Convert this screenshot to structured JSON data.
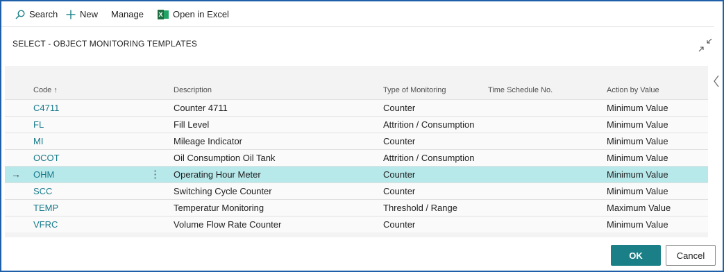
{
  "toolbar": {
    "search_label": "Search",
    "new_label": "New",
    "manage_label": "Manage",
    "excel_label": "Open in Excel",
    "excel_icon_glyph": "X"
  },
  "page": {
    "title": "SELECT - OBJECT MONITORING TEMPLATES"
  },
  "table": {
    "columns": {
      "code": "Code",
      "code_sort": "↑",
      "description": "Description",
      "type": "Type of Monitoring",
      "schedule": "Time Schedule No.",
      "action": "Action by Value"
    },
    "rows": [
      {
        "code": "C4711",
        "description": "Counter 4711",
        "type": "Counter",
        "schedule": "",
        "action": "Minimum Value"
      },
      {
        "code": "FL",
        "description": "Fill Level",
        "type": "Attrition / Consumption",
        "schedule": "",
        "action": "Minimum Value"
      },
      {
        "code": "MI",
        "description": "Mileage Indicator",
        "type": "Counter",
        "schedule": "",
        "action": "Minimum Value"
      },
      {
        "code": "OCOT",
        "description": "Oil Consumption Oil Tank",
        "type": "Attrition / Consumption",
        "schedule": "",
        "action": "Minimum Value"
      },
      {
        "code": "OHM",
        "description": "Operating Hour Meter",
        "type": "Counter",
        "schedule": "",
        "action": "Minimum Value"
      },
      {
        "code": "SCC",
        "description": "Switching Cycle Counter",
        "type": "Counter",
        "schedule": "",
        "action": "Minimum Value"
      },
      {
        "code": "TEMP",
        "description": "Temperatur Monitoring",
        "type": "Threshold / Range",
        "schedule": "",
        "action": "Maximum Value"
      },
      {
        "code": "VFRC",
        "description": "Volume Flow Rate Counter",
        "type": "Counter",
        "schedule": "",
        "action": "Minimum Value"
      }
    ],
    "selected_arrow": "→",
    "row_menu_glyph": "⋮"
  },
  "footer": {
    "ok_label": "OK",
    "cancel_label": "Cancel"
  },
  "colors": {
    "accent": "#1a7f87",
    "link": "#177a8a",
    "selected_row": "#b7e8ea",
    "frame": "#1f5ea8"
  }
}
